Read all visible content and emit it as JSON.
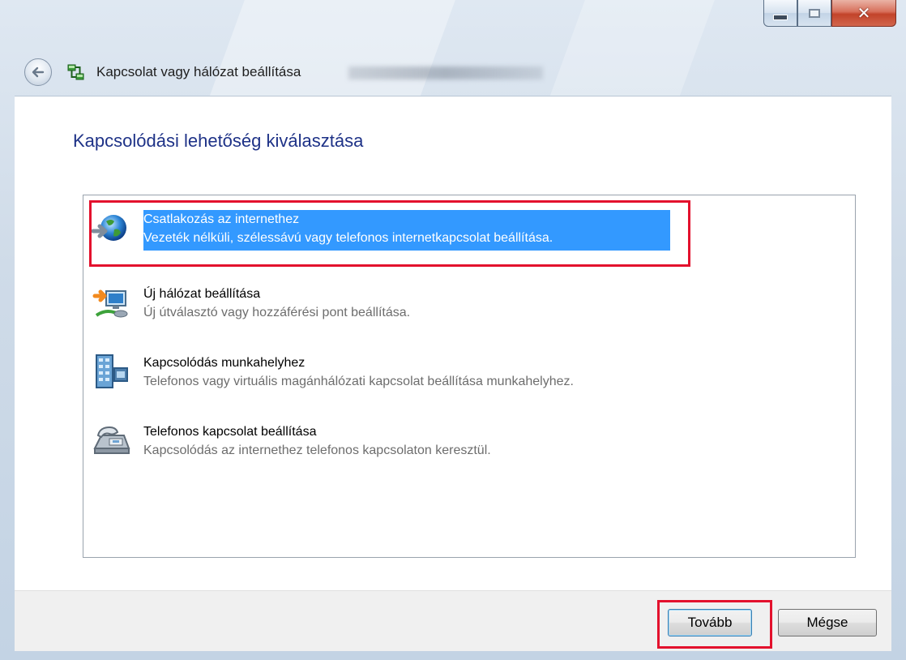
{
  "window": {
    "title": "Kapcsolat vagy hálózat beállítása",
    "controls": {
      "minimize": "minimize",
      "maximize": "maximize",
      "close": "close"
    }
  },
  "page": {
    "heading": "Kapcsolódási lehetőség kiválasztása"
  },
  "options": [
    {
      "title": "Csatlakozás az internethez",
      "description": "Vezeték nélküli, szélessávú vagy telefonos internetkapcsolat beállítása.",
      "icon": "globe-icon",
      "selected": true
    },
    {
      "title": "Új hálózat beállítása",
      "description": "Új útválasztó vagy hozzáférési pont beállítása.",
      "icon": "network-setup-icon",
      "selected": false
    },
    {
      "title": "Kapcsolódás munkahelyhez",
      "description": "Telefonos vagy virtuális magánhálózati kapcsolat beállítása munkahelyhez.",
      "icon": "workplace-building-icon",
      "selected": false
    },
    {
      "title": "Telefonos kapcsolat beállítása",
      "description": "Kapcsolódás az internethez telefonos kapcsolaton keresztül.",
      "icon": "telephone-icon",
      "selected": false
    }
  ],
  "footer": {
    "next_label": "Tovább",
    "cancel_label": "Mégse"
  },
  "colors": {
    "selection": "#3399ff",
    "highlight_box": "#e3112d",
    "heading": "#1e3287"
  }
}
